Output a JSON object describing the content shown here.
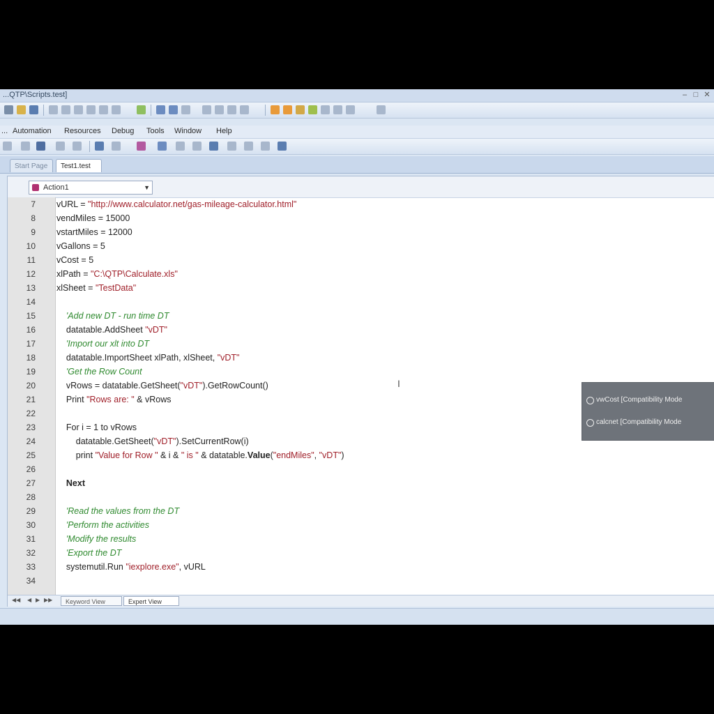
{
  "window": {
    "title": "...QTP\\Scripts.test]",
    "minimize": "–",
    "maximize": "□",
    "close": "✕"
  },
  "menu": [
    "...",
    "Automation",
    "Resources",
    "Debug",
    "Tools",
    "Window",
    "Help"
  ],
  "tabs": [
    {
      "label": "Start Page",
      "active": false
    },
    {
      "label": "Test1.test",
      "active": true
    }
  ],
  "object_selector": {
    "value": "Action1",
    "icon": "action-icon"
  },
  "code_lines": [
    {
      "n": "7",
      "segs": [
        {
          "t": "vURL = "
        },
        {
          "t": "\"http://www.calculator.net/gas-mileage-calculator.html\"",
          "c": "str"
        }
      ]
    },
    {
      "n": "8",
      "segs": [
        {
          "t": "vendMiles = 15000"
        }
      ]
    },
    {
      "n": "9",
      "segs": [
        {
          "t": "vstartMiles = 12000"
        }
      ]
    },
    {
      "n": "10",
      "segs": [
        {
          "t": "vGallons = 5"
        }
      ]
    },
    {
      "n": "11",
      "segs": [
        {
          "t": "vCost = 5"
        }
      ]
    },
    {
      "n": "12",
      "segs": [
        {
          "t": "xlPath = "
        },
        {
          "t": "\"C:\\QTP\\Calculate.xls\"",
          "c": "str"
        }
      ]
    },
    {
      "n": "13",
      "segs": [
        {
          "t": "xlSheet = "
        },
        {
          "t": "\"TestData\"",
          "c": "str"
        }
      ]
    },
    {
      "n": "14",
      "segs": []
    },
    {
      "n": "15",
      "segs": [
        {
          "t": "    'Add new DT - run time DT",
          "c": "cmt"
        }
      ]
    },
    {
      "n": "16",
      "segs": [
        {
          "t": "    datatable.AddSheet "
        },
        {
          "t": "\"vDT\"",
          "c": "str"
        }
      ]
    },
    {
      "n": "17",
      "segs": [
        {
          "t": "    'Import our xlt into DT",
          "c": "cmt"
        }
      ]
    },
    {
      "n": "18",
      "segs": [
        {
          "t": "    datatable.ImportSheet xlPath, xlSheet, "
        },
        {
          "t": "\"vDT\"",
          "c": "str"
        }
      ]
    },
    {
      "n": "19",
      "segs": [
        {
          "t": "    'Get the Row Count",
          "c": "cmt"
        }
      ]
    },
    {
      "n": "20",
      "segs": [
        {
          "t": "    vRows = datatable.GetSheet("
        },
        {
          "t": "\"vDT\"",
          "c": "str"
        },
        {
          "t": ").GetRowCount()"
        }
      ]
    },
    {
      "n": "21",
      "segs": [
        {
          "t": "    Print "
        },
        {
          "t": "\"Rows are: \"",
          "c": "str"
        },
        {
          "t": " & vRows"
        }
      ]
    },
    {
      "n": "22",
      "segs": []
    },
    {
      "n": "23",
      "segs": [
        {
          "t": "    For i = 1 to vRows"
        }
      ]
    },
    {
      "n": "24",
      "segs": [
        {
          "t": "        datatable.GetSheet("
        },
        {
          "t": "\"vDT\"",
          "c": "str"
        },
        {
          "t": ").SetCurrentRow(i)"
        }
      ]
    },
    {
      "n": "25",
      "segs": [
        {
          "t": "        print "
        },
        {
          "t": "\"Value for Row \"",
          "c": "str"
        },
        {
          "t": " & i & "
        },
        {
          "t": "\" is \"",
          "c": "str"
        },
        {
          "t": " & datatable."
        },
        {
          "t": "Value",
          "c": "kw"
        },
        {
          "t": "("
        },
        {
          "t": "\"endMiles\"",
          "c": "str"
        },
        {
          "t": ", "
        },
        {
          "t": "\"vDT\"",
          "c": "str"
        },
        {
          "t": ")"
        }
      ]
    },
    {
      "n": "26",
      "segs": []
    },
    {
      "n": "27",
      "segs": [
        {
          "t": "    "
        },
        {
          "t": "Next",
          "c": "kw"
        }
      ]
    },
    {
      "n": "28",
      "segs": []
    },
    {
      "n": "29",
      "segs": [
        {
          "t": "    'Read the values from the DT",
          "c": "cmt"
        }
      ]
    },
    {
      "n": "30",
      "segs": [
        {
          "t": "    'Perform the activities",
          "c": "cmt"
        }
      ]
    },
    {
      "n": "31",
      "segs": [
        {
          "t": "    'Modify the results",
          "c": "cmt"
        }
      ]
    },
    {
      "n": "32",
      "segs": [
        {
          "t": "    'Export the DT",
          "c": "cmt"
        }
      ]
    },
    {
      "n": "33",
      "segs": [
        {
          "t": "    systemutil.Run "
        },
        {
          "t": "\"iexplore.exe\"",
          "c": "str"
        },
        {
          "t": ", vURL"
        }
      ]
    },
    {
      "n": "34",
      "segs": []
    }
  ],
  "view_tabs": [
    {
      "label": "Keyword View",
      "active": false
    },
    {
      "label": "Expert View",
      "active": true
    }
  ],
  "notification": {
    "rows": [
      {
        "text": "vwCost [Compatibility Mode"
      },
      {
        "text": "calcnet [Compatibility Mode"
      }
    ]
  },
  "colors": {
    "string": "#a0202a",
    "comment": "#2f8a2f",
    "gutter": "#e4e4e4",
    "chrome": "#dbe6f3"
  }
}
